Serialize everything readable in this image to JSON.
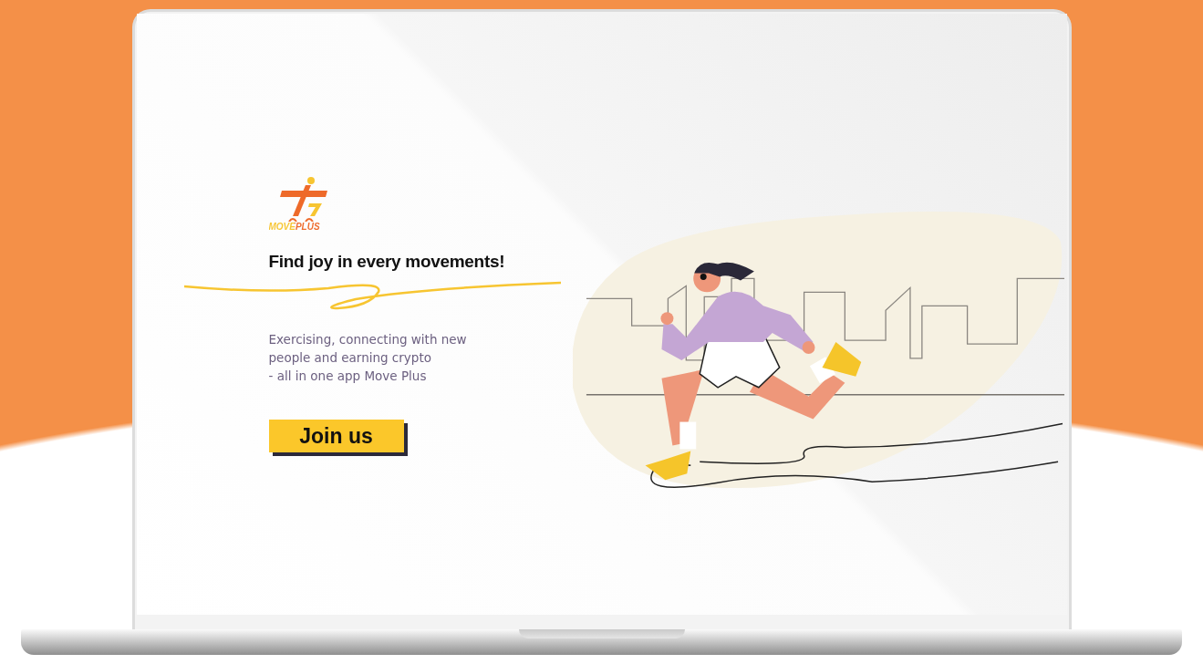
{
  "logo": {
    "text": "MOVEPLUS"
  },
  "hero": {
    "headline": "Find joy in every movements!",
    "description": "Exercising, connecting with new\npeople and earning crypto\n- all in one app Move Plus",
    "button": "Join us"
  }
}
